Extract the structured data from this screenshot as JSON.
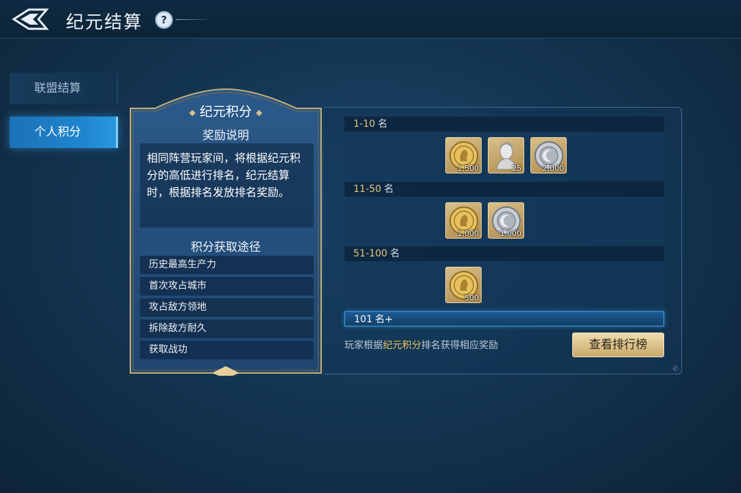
{
  "header": {
    "title": "纪元结算",
    "help_label": "?"
  },
  "sidebar": {
    "items": [
      {
        "label": "联盟结算"
      },
      {
        "label": "个人积分"
      }
    ]
  },
  "info_panel": {
    "title": "纪元积分",
    "reward_heading": "奖励说明",
    "reward_desc": "相同阵营玩家间，将根据纪元积分的高低进行排名，纪元结算时，根据排名发放排名奖励。",
    "ways_heading": "积分获取途径",
    "ways": [
      "历史最高生产力",
      "首次攻占城市",
      "攻占敌方领地",
      "拆除敌方耐久",
      "获取战功"
    ]
  },
  "rewards": {
    "tiers": [
      {
        "range": "1-10",
        "unit": "名",
        "items": [
          {
            "icon": "gold-coin-icon",
            "count": "1,500"
          },
          {
            "icon": "bust-statue-icon",
            "count": "25"
          },
          {
            "icon": "silver-medal-icon",
            "count": "2,000"
          }
        ]
      },
      {
        "range": "11-50",
        "unit": "名",
        "items": [
          {
            "icon": "gold-coin-icon",
            "count": "1,000"
          },
          {
            "icon": "silver-medal-icon",
            "count": "1,000"
          }
        ]
      },
      {
        "range": "51-100",
        "unit": "名",
        "items": [
          {
            "icon": "gold-coin-icon",
            "count": "500"
          }
        ]
      },
      {
        "range": "101",
        "unit": "名+",
        "items": []
      }
    ],
    "footer_prefix": "玩家根据",
    "footer_highlight": "纪元积分",
    "footer_suffix": "排名获得相应奖励",
    "button_label": "查看排行榜",
    "corner_mark": "必"
  },
  "colors": {
    "accent_gold": "#e9c77b",
    "tab_active": "#1f86cf",
    "highlight": "#f0c25c"
  }
}
